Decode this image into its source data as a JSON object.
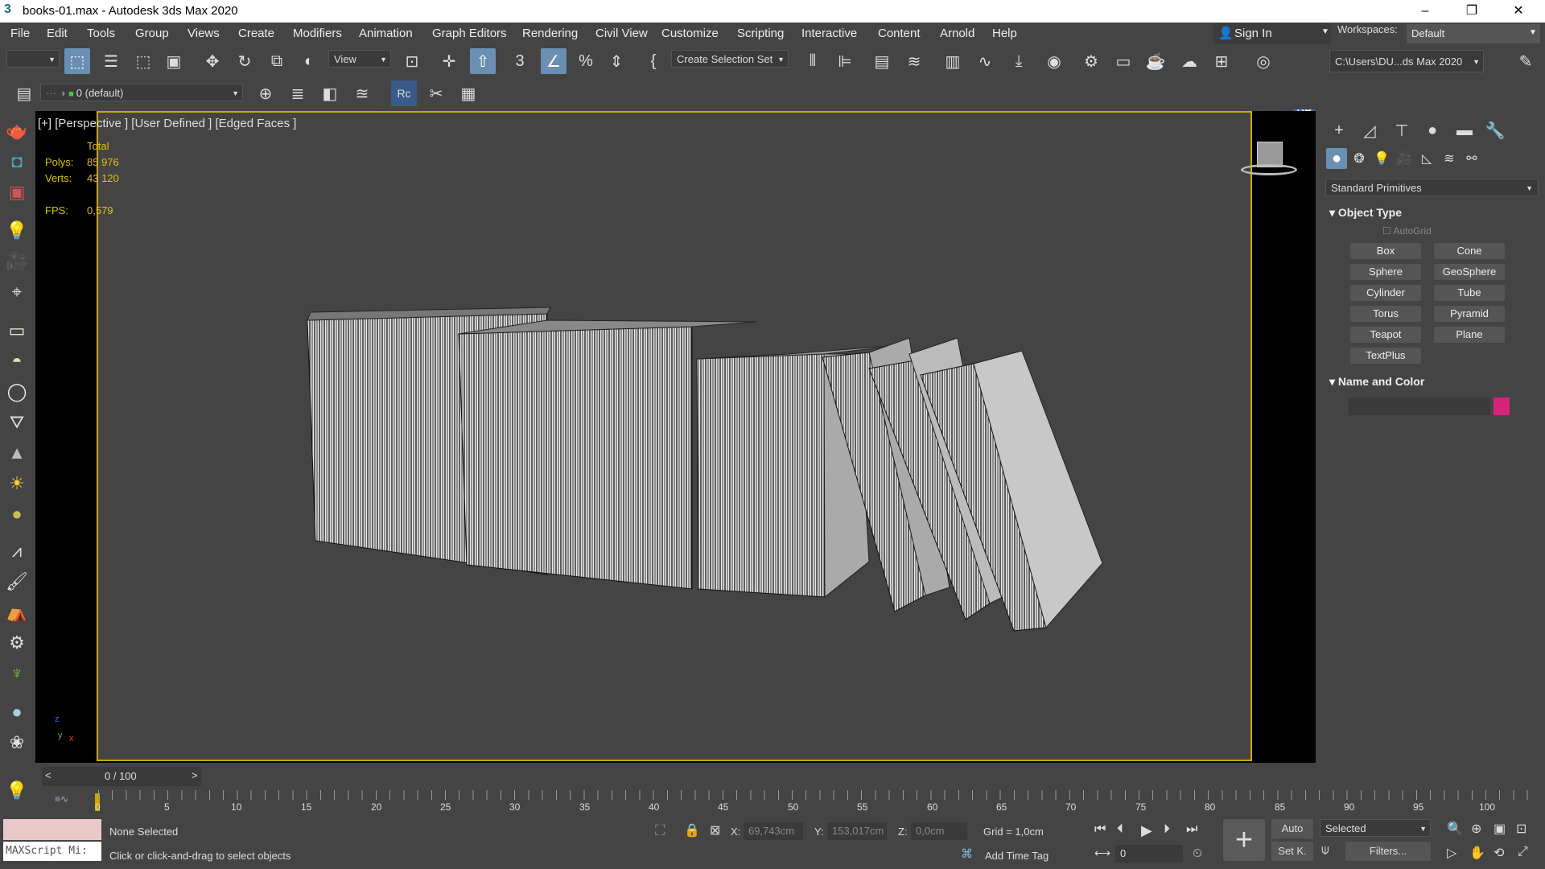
{
  "window": {
    "title": "books-01.max - Autodesk 3ds Max 2020",
    "minimize": "–",
    "restore": "❐",
    "close": "✕"
  },
  "menubar": {
    "items": [
      "File",
      "Edit",
      "Tools",
      "Group",
      "Views",
      "Create",
      "Modifiers",
      "Animation",
      "Graph Editors",
      "Rendering",
      "Civil View",
      "Customize",
      "Scripting",
      "Interactive",
      "Content",
      "Arnold",
      "Help"
    ],
    "sign_in": "Sign In",
    "workspaces_label": "Workspaces:",
    "workspace_value": "Default"
  },
  "toolbar": {
    "view_dropdown": "View",
    "selection_set": "Create Selection Set",
    "project_path": "C:\\Users\\DU...ds Max 2020",
    "rb_label": "RB",
    "layer_dropdown": "0 (default)"
  },
  "viewport": {
    "label": "[+] [Perspective ] [User Defined ] [Edged Faces ]",
    "total_label": "Total",
    "polys_label": "Polys:",
    "polys_value": "85 976",
    "verts_label": "Verts:",
    "verts_value": "43 120",
    "fps_label": "FPS:",
    "fps_value": "0,579"
  },
  "command_panel": {
    "category_dropdown": "Standard Primitives",
    "object_type_title": "Object Type",
    "autogrid": "AutoGrid",
    "buttons": [
      "Box",
      "Cone",
      "Sphere",
      "GeoSphere",
      "Cylinder",
      "Tube",
      "Torus",
      "Pyramid",
      "Teapot",
      "Plane",
      "TextPlus"
    ],
    "name_color_title": "Name and Color",
    "color_swatch": "#d6237c"
  },
  "timeline": {
    "frame_display": "0 / 100",
    "prev": "<",
    "next": ">",
    "ticks": [
      "0",
      "5",
      "10",
      "15",
      "20",
      "25",
      "30",
      "35",
      "40",
      "45",
      "50",
      "55",
      "60",
      "65",
      "70",
      "75",
      "80",
      "85",
      "90",
      "95",
      "100"
    ]
  },
  "statusbar": {
    "maxscript": "MAXScript Mi:",
    "selection_status": "None Selected",
    "prompt": "Click or click-and-drag to select objects",
    "x_label": "X:",
    "x_value": "69,743cm",
    "y_label": "Y:",
    "y_value": "153,017cm",
    "z_label": "Z:",
    "z_value": "0,0cm",
    "grid": "Grid = 1,0cm",
    "add_time_tag": "Add Time Tag",
    "auto_key": "Auto",
    "set_key": "Set K.",
    "selected_dropdown": "Selected",
    "filters": "Filters...",
    "frame_input": "0"
  }
}
